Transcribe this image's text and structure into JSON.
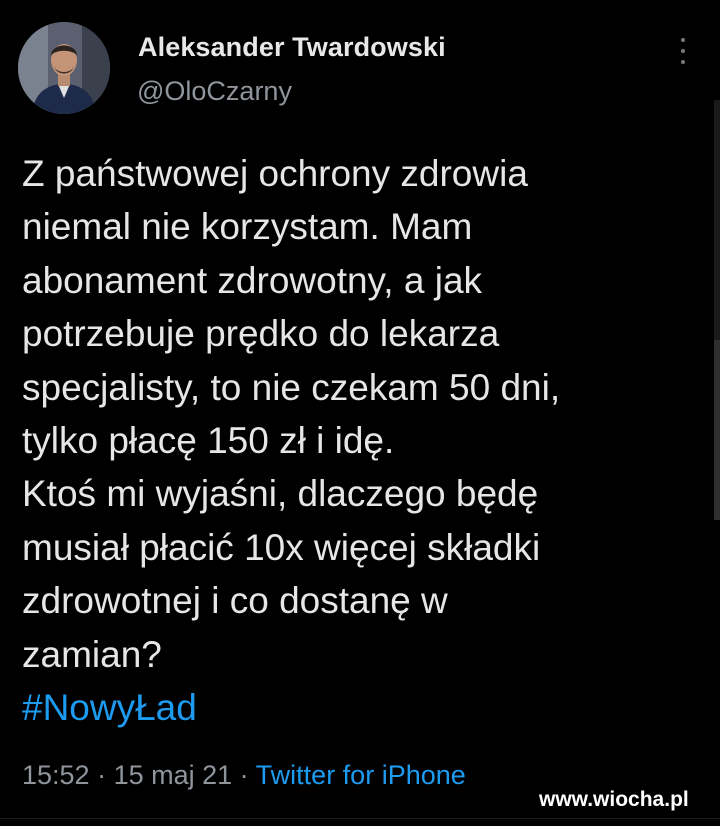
{
  "tweet": {
    "author_name": "Aleksander Twardowski",
    "author_handle": "@OloCzarny",
    "more_icon": "more-vertical-icon",
    "lines": [
      "Z państwowej ochrony zdrowia",
      "niemal nie korzystam. Mam",
      "abonament zdrowotny, a jak",
      "potrzebuje prędko do lekarza",
      "specjalisty, to nie czekam 50 dni,",
      "tylko płacę 150 zł i idę.",
      "Ktoś mi wyjaśni, dlaczego będę",
      "musiał płacić 10x więcej składki",
      "zdrowotnej i co dostanę w",
      "zamian?"
    ],
    "hashtag": "#NowyŁad",
    "time": "15:52",
    "separator": " · ",
    "date": "15 maj 21",
    "source": "Twitter for iPhone"
  },
  "watermark": "www.wiocha.pl",
  "colors": {
    "background": "#000000",
    "text": "#e6e6e6",
    "secondary": "#8f959b",
    "accent": "#1d9bf0"
  }
}
